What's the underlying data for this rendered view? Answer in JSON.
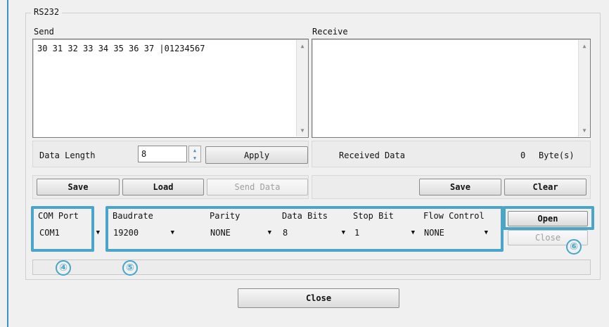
{
  "group_title": "RS232",
  "send": {
    "label": "Send",
    "content": "30 31 32 33 34 35 36 37 |01234567"
  },
  "receive": {
    "label": "Receive",
    "content": ""
  },
  "data_length": {
    "label": "Data Length",
    "value": "8",
    "apply_label": "Apply"
  },
  "received": {
    "label": "Received Data",
    "count": "0",
    "unit": "Byte(s)"
  },
  "send_buttons": {
    "save": "Save",
    "load": "Load",
    "send_data": "Send Data"
  },
  "receive_buttons": {
    "save": "Save",
    "clear": "Clear"
  },
  "com": {
    "port_label": "COM Port",
    "port_value": "COM1",
    "baud_label": "Baudrate",
    "baud_value": "19200",
    "parity_label": "Parity",
    "parity_value": "NONE",
    "databits_label": "Data Bits",
    "databits_value": "8",
    "stopbit_label": "Stop Bit",
    "stopbit_value": "1",
    "flow_label": "Flow Control",
    "flow_value": "NONE"
  },
  "port_buttons": {
    "open": "Open",
    "close": "Close"
  },
  "markers": {
    "m4": "④",
    "m5": "⑤",
    "m6": "⑥"
  },
  "bottom": {
    "close": "Close"
  },
  "colors": {
    "highlight": "#4aa5c9",
    "window_edge": "#3c8fd0"
  },
  "icons": {
    "dropdown": "chevron-down-icon",
    "spin_up": "spin-up-icon",
    "spin_down": "spin-down-icon",
    "scroll_up": "scroll-up-icon",
    "scroll_down": "scroll-down-icon"
  }
}
